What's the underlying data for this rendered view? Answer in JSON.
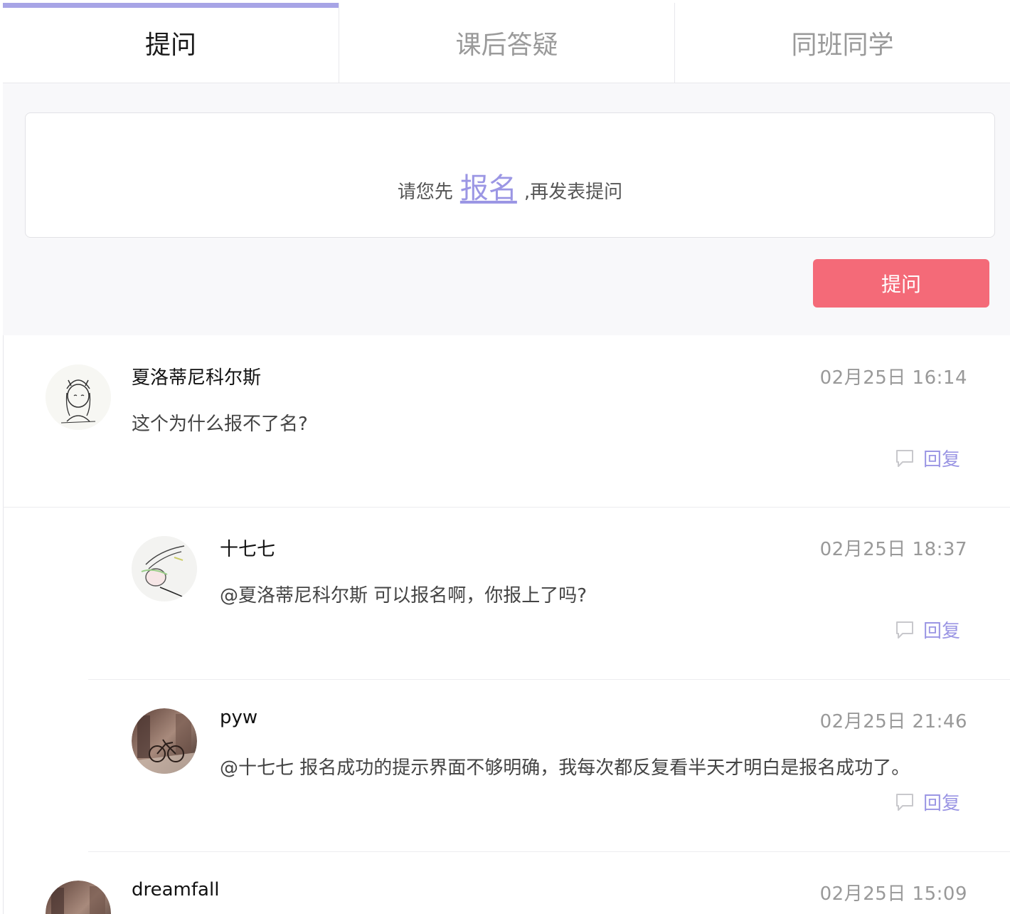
{
  "tabs": [
    {
      "label": "提问",
      "active": true
    },
    {
      "label": "课后答疑",
      "active": false
    },
    {
      "label": "同班同学",
      "active": false
    }
  ],
  "compose": {
    "prompt_before": "请您先",
    "signup_link": "报名",
    "prompt_after": ",再发表提问",
    "submit_label": "提问"
  },
  "comments": [
    {
      "name": "夏洛蒂尼科尔斯",
      "time": "02月25日 16:14",
      "text": "这个为什么报不了名?",
      "reply_label": "回复",
      "avatar": "sketch-girl"
    },
    {
      "name": "十七七",
      "time": "02月25日 18:37",
      "text": "@夏洛蒂尼科尔斯 可以报名啊，你报上了吗?",
      "reply_label": "回复",
      "avatar": "sketch-face"
    },
    {
      "name": "pyw",
      "time": "02月25日 21:46",
      "text": "@十七七 报名成功的提示界面不够明确，我每次都反复看半天才明白是报名成功了。",
      "reply_label": "回复",
      "avatar": "bicycle-photo"
    },
    {
      "name": "dreamfall",
      "time": "02月25日 15:09",
      "text": "",
      "reply_label": "",
      "avatar": "bicycle-photo"
    }
  ],
  "colors": {
    "accent": "#9b96e4",
    "tab_indicator": "#a7a4e6",
    "button": "#f46a78",
    "background": "#f8f8fa"
  }
}
